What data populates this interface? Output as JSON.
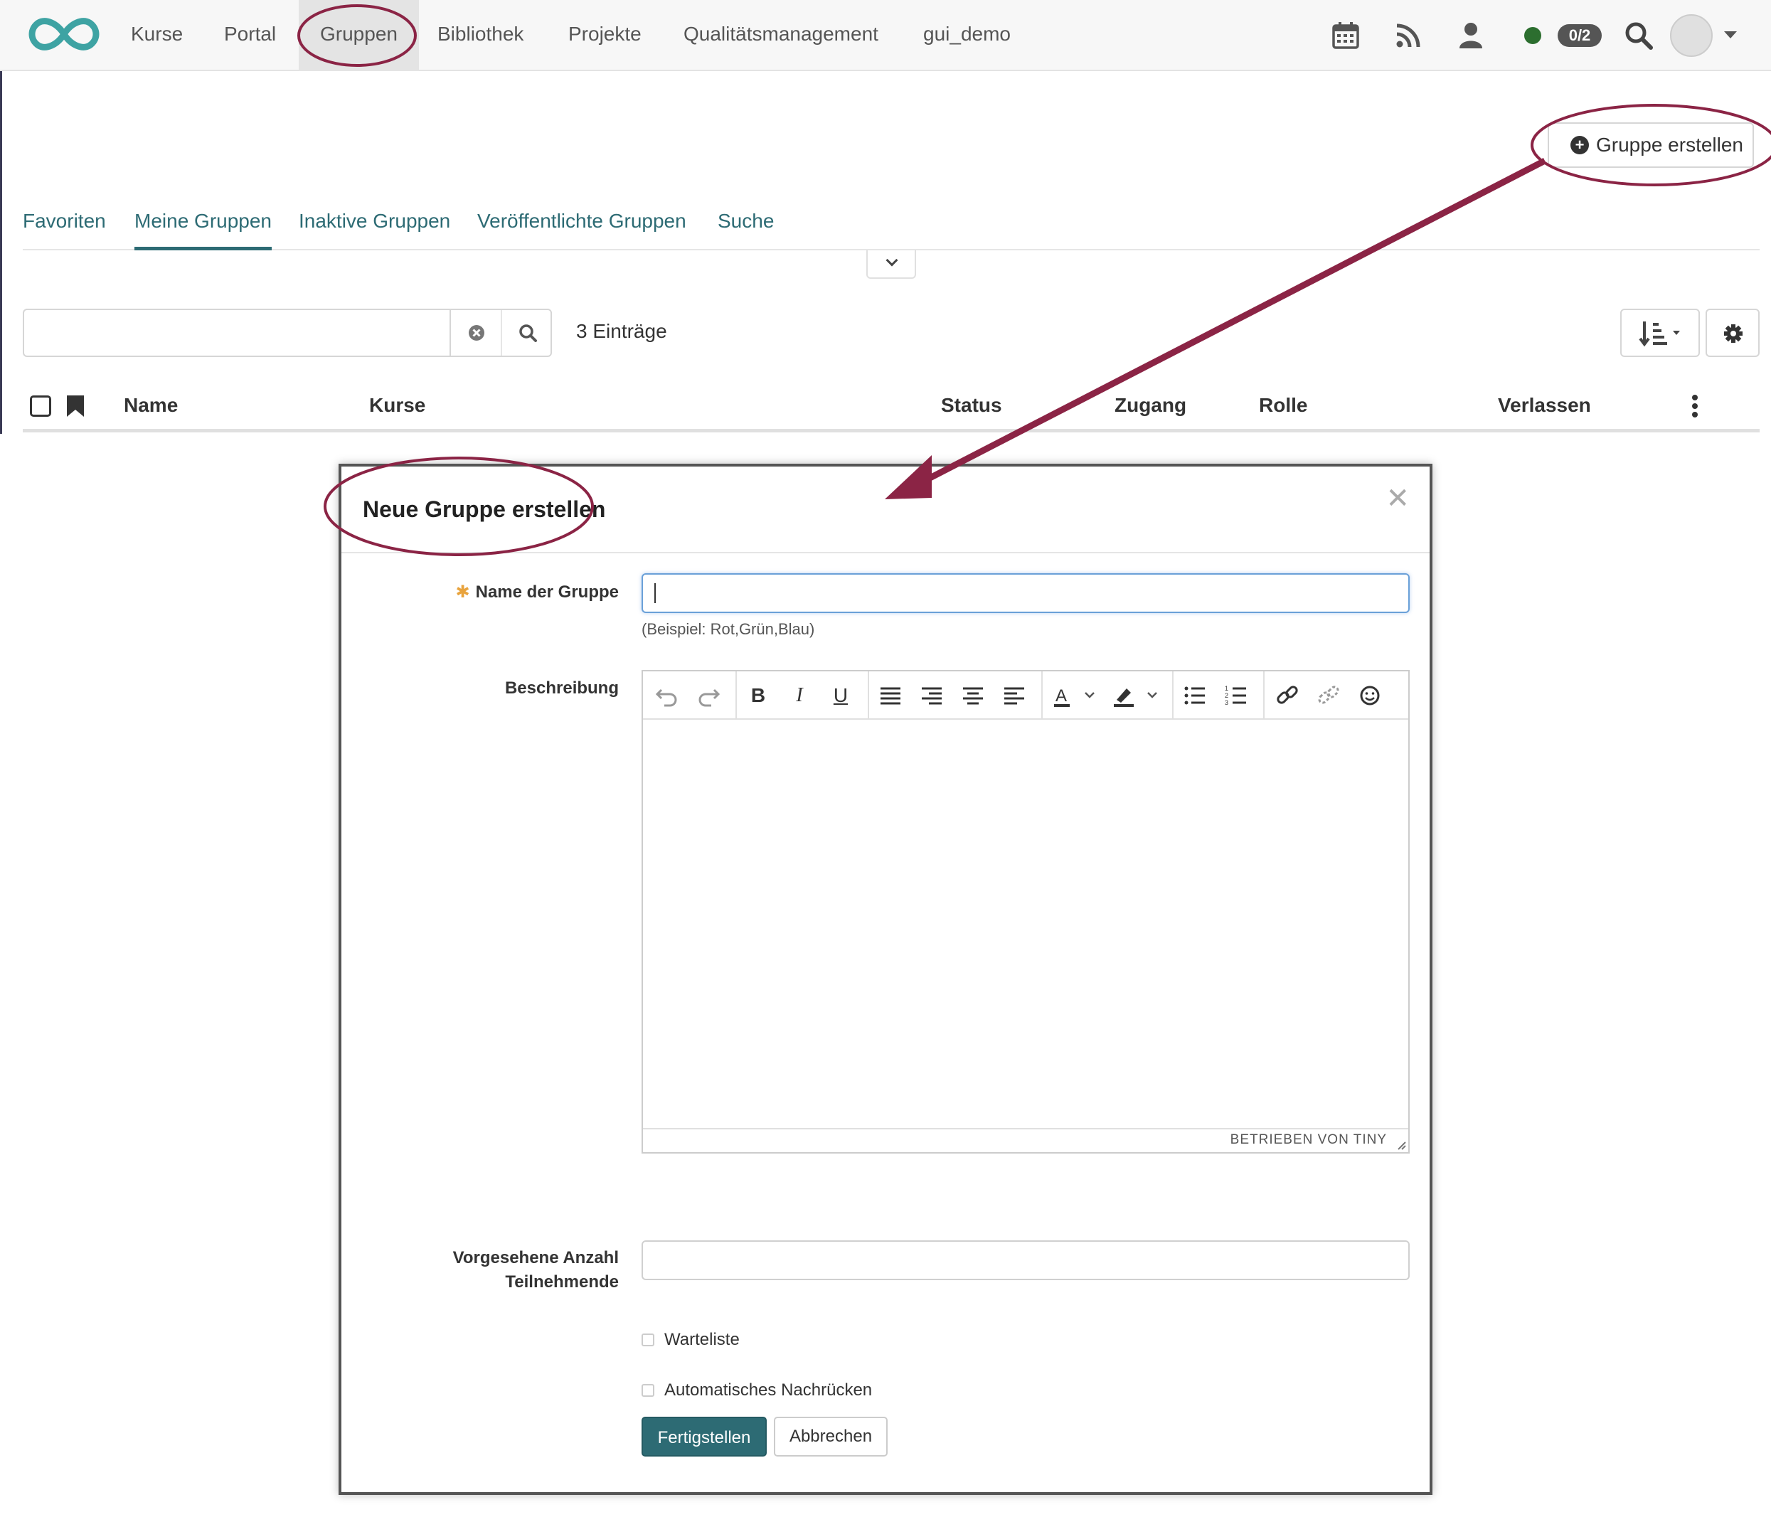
{
  "nav": {
    "items": [
      "Kurse",
      "Portal",
      "Gruppen",
      "Bibliothek",
      "Projekte",
      "Qualitätsmanagement",
      "gui_demo"
    ],
    "active": "Gruppen",
    "counter_badge": "0/2",
    "icons": [
      "calendar-icon",
      "rss-icon",
      "user-icon",
      "status-dot",
      "search-icon",
      "avatar"
    ]
  },
  "toolbar": {
    "create_group_label": "Gruppe erstellen"
  },
  "tabs": [
    "Favoriten",
    "Meine Gruppen",
    "Inaktive Gruppen",
    "Veröffentlichte Gruppen",
    "Suche"
  ],
  "active_tab": "Meine Gruppen",
  "search": {
    "value": "",
    "entries_label": "3 Einträge"
  },
  "table": {
    "columns": [
      "Name",
      "Kurse",
      "Status",
      "Zugang",
      "Rolle",
      "Verlassen"
    ]
  },
  "modal": {
    "title": "Neue Gruppe erstellen",
    "name_label": "Name der Gruppe",
    "name_value": "",
    "name_hint": "(Beispiel: Rot,Grün,Blau)",
    "description_label": "Beschreibung",
    "editor_powered_by": "BETRIEBEN VON TINY",
    "participants_label_line1": "Vorgesehene Anzahl",
    "participants_label_line2": "Teilnehmende",
    "participants_value": "",
    "waitlist_label": "Warteliste",
    "auto_move_label": "Automatisches Nachrücken",
    "finish_label": "Fertigstellen",
    "cancel_label": "Abbrechen"
  },
  "colors": {
    "accent": "#2d6b74",
    "annotation": "#8b2445",
    "required_star": "#e8a33d",
    "status_online": "#2c6e2f"
  }
}
